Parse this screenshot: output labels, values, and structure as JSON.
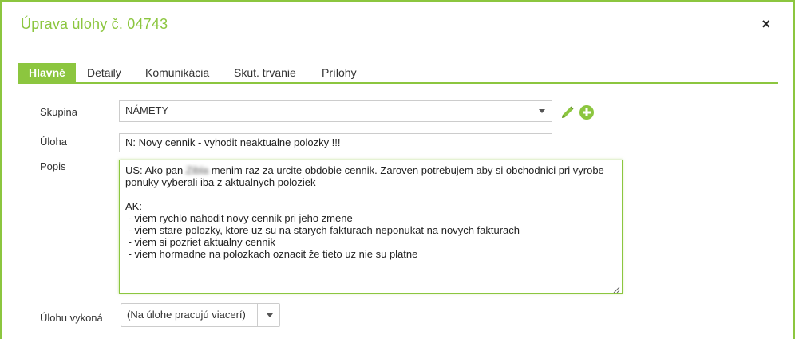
{
  "dialog": {
    "title": "Úprava úlohy č. 04743",
    "close_label": "×"
  },
  "tabs": [
    {
      "label": "Hlavné",
      "active": true
    },
    {
      "label": "Detaily",
      "active": false
    },
    {
      "label": "Komunikácia",
      "active": false
    },
    {
      "label": "Skut. trvanie",
      "active": false
    },
    {
      "label": "Prílohy",
      "active": false
    }
  ],
  "form": {
    "group": {
      "label": "Skupina",
      "value": "NÁMETY"
    },
    "task": {
      "label": "Úloha",
      "value": "N: Novy cennik - vyhodit neaktualne polozky !!!"
    },
    "description": {
      "label": "Popis",
      "lines": [
        {
          "before": "US: Ako pan ",
          "redacted": "Zibla",
          "after": " menim raz za urcite obdobie cennik. Zaroven potrebujem aby si obchodnici pri vyrobe"
        },
        {
          "text": "ponuky vyberali iba z aktualnych poloziek"
        },
        {
          "text": ""
        },
        {
          "text": "AK:"
        },
        {
          "text": " - viem rychlo nahodit novy cennik pri jeho zmene"
        },
        {
          "text": " - viem stare polozky, ktore uz su na starych fakturach neponukat na novych fakturach"
        },
        {
          "text": " - viem si pozriet aktualny cennik"
        },
        {
          "text": " - viem hormadne na polozkach oznacit že tieto uz nie su platne"
        }
      ]
    },
    "assignee": {
      "label": "Úlohu vykoná",
      "value": "(Na úlohe pracujú viacerí)"
    }
  },
  "colors": {
    "accent": "#8cc63f",
    "text": "#333333",
    "border": "#cccccc"
  },
  "icons": {
    "edit": "pencil-icon",
    "add": "plus-circle-icon",
    "dropdown": "chevron-down-icon"
  }
}
